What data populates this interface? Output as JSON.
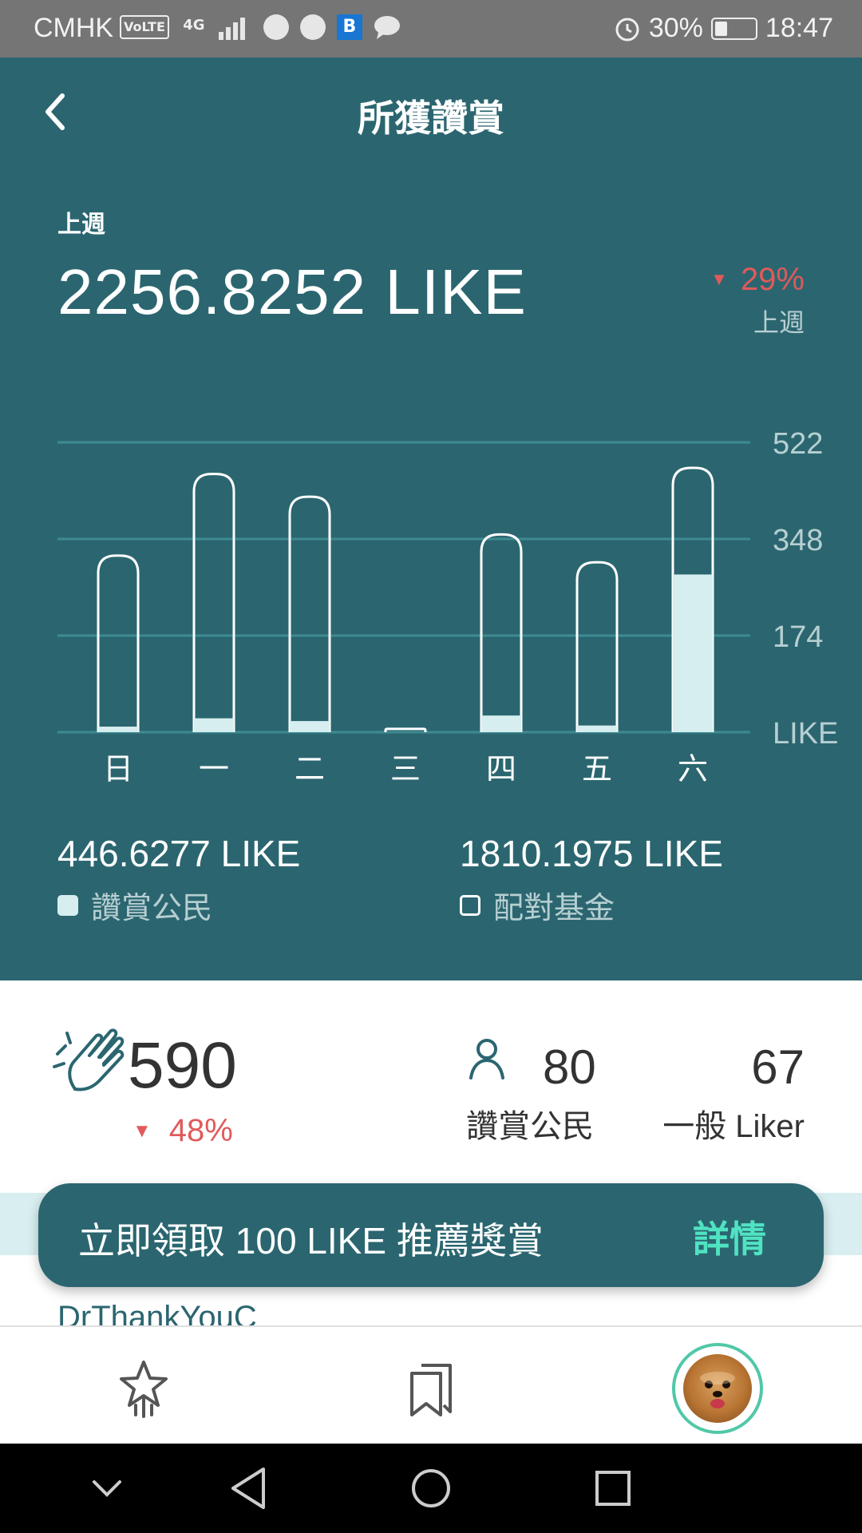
{
  "status_bar": {
    "carrier": "CMHK",
    "volte": "VoLTE",
    "network": "4G",
    "battery_percent": "30%",
    "battery_level": 0.3,
    "time": "18:47"
  },
  "header": {
    "title": "所獲讚賞",
    "period_label": "上週",
    "total_value": "2256.8252 LIKE",
    "change": {
      "direction": "down",
      "value": "29%",
      "label": "上週"
    }
  },
  "chart_data": {
    "type": "bar",
    "stacked": true,
    "categories": [
      "日",
      "一",
      "二",
      "三",
      "四",
      "五",
      "六"
    ],
    "series": [
      {
        "name": "讚賞公民",
        "values": [
          10,
          25,
          20,
          0,
          30,
          12,
          284
        ]
      },
      {
        "name": "配對基金",
        "values": [
          308,
          440,
          404,
          6,
          326,
          294,
          192
        ]
      }
    ],
    "y_ticks": [
      "522",
      "348",
      "174",
      "LIKE"
    ],
    "y_tick_values": [
      522,
      348,
      174,
      0
    ],
    "ylim": [
      0,
      522
    ],
    "grid": true
  },
  "legend": {
    "civic": {
      "value": "446.6277 LIKE",
      "label": "讚賞公民"
    },
    "matching": {
      "value": "1810.1975 LIKE",
      "label": "配對基金"
    }
  },
  "stats": {
    "likes_count": "590",
    "likes_change": "48%",
    "civic_count": "80",
    "civic_label": "讚賞公民",
    "general_count": "67",
    "general_label": "一般 Liker"
  },
  "promo": {
    "text": "立即領取 100 LIKE 推薦獎賞",
    "detail": "詳情"
  },
  "feed_peek": "DrThankYouC",
  "colors": {
    "primary": "#2b6670",
    "accent": "#50e3c2",
    "negative": "#e05a5a",
    "bar_fill": "#d6eeef"
  },
  "icons": {
    "back": "chevron-left-icon",
    "clap": "clap-icon",
    "person": "person-icon",
    "tab1": "star-icon",
    "tab2": "bookmarks-icon"
  }
}
